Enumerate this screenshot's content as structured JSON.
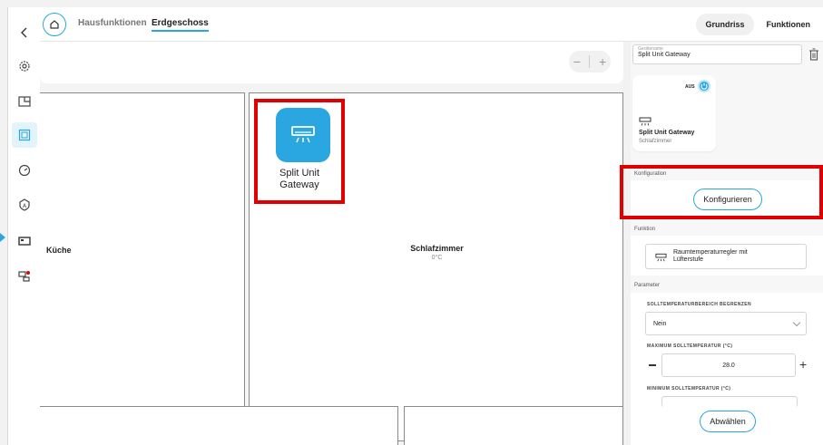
{
  "breadcrumbs": [
    "Hausfunktionen",
    "Erdgeschoss"
  ],
  "view_toggle": {
    "grundriss": "Grundriss",
    "funktionen": "Funktionen"
  },
  "zoom": {
    "minus": "−",
    "plus": "+"
  },
  "rooms": {
    "kueche": {
      "label": "Küche"
    },
    "schlafzimmer": {
      "label": "Schlafzimmer",
      "temp": "0°C"
    }
  },
  "device": {
    "name_line1": "Split Unit",
    "name_line2": "Gateway"
  },
  "panel": {
    "name_field": {
      "label": "Gerätename",
      "value": "Split Unit Gateway"
    },
    "device_card": {
      "state": "AUS",
      "title": "Split Unit Gateway",
      "room": "Schlafzimmer"
    },
    "konfiguration": {
      "label": "Konfiguration",
      "button": "Konfigurieren"
    },
    "funktion": {
      "label": "Funktion",
      "value": "Raumtemperaturregler mit Lüfterstufe"
    },
    "parameter": {
      "label": "Parameter",
      "range_label": "SOLLTEMPERATURBEREICH BEGRENZEN",
      "range_value": "Nein",
      "max_label": "MAXIMUM SOLLTEMPERATUR (°C)",
      "max_value": "28.0",
      "min_label": "MINIMUM SOLLTEMPERATUR (°C)"
    },
    "deselect_button": "Abwählen"
  },
  "colors": {
    "accent": "#2aa6e0",
    "highlight": "#e10000"
  },
  "icons": [
    "back-icon",
    "home-icon",
    "gear-icon",
    "floorplan-icon",
    "grid-icon",
    "gauge-icon",
    "shield-icon",
    "display-icon",
    "network-icon",
    "trash-icon",
    "power-icon",
    "air-conditioner-icon"
  ]
}
